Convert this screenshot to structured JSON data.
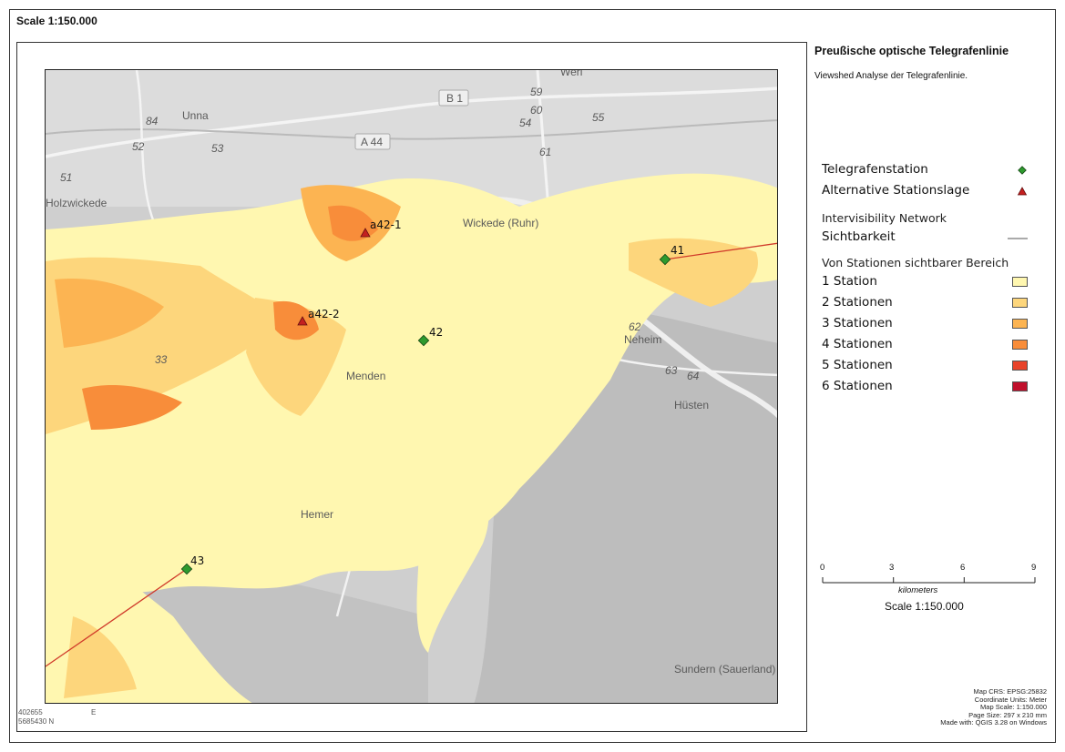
{
  "layout": {
    "scale_top": "Scale 1:150.000",
    "coord_x": "402655",
    "coord_e": "E",
    "coord_y": "5685430 N"
  },
  "title": "Preußische optische Telegrafenlinie",
  "subtitle": "Viewshed Analyse der Telegrafenlinie.",
  "legend": {
    "telegraph_station": "Telegrafenstation",
    "alt_station": "Alternative Stationslage",
    "network_heading": "Intervisibility Network",
    "visibility": "Sichtbarkeit",
    "viewshed_heading": "Von Stationen sichtbarer Bereich",
    "classes": [
      {
        "label": "1 Station",
        "color": "#fff7b0"
      },
      {
        "label": "2 Stationen",
        "color": "#fdd67c"
      },
      {
        "label": "3 Stationen",
        "color": "#fcb452"
      },
      {
        "label": "4 Stationen",
        "color": "#f88d3a"
      },
      {
        "label": "5 Stationen",
        "color": "#e8432a"
      },
      {
        "label": "6 Stationen",
        "color": "#c0102c"
      }
    ],
    "station_color": "#2e9a2e",
    "alt_color": "#c42020",
    "line_color": "#d03a2a"
  },
  "scalebar": {
    "ticks": [
      "0",
      "3",
      "6",
      "9"
    ],
    "unit": "kilometers",
    "scale_text": "Scale 1:150.000"
  },
  "info": {
    "crs": "Map CRS: EPSG:25832",
    "units": "Coordinate Units: Meter",
    "scale": "Map Scale:  1:150.000",
    "page": "Page Size: 297 x 210 mm",
    "made": "Made with: QGIS 3.28 on Windows"
  },
  "map": {
    "places": [
      "Unna",
      "Holzwickede",
      "Wickede (Ruhr)",
      "Menden",
      "Neheim",
      "Hüsten",
      "Hemer",
      "Sundern (Sauerland)",
      "Werl"
    ],
    "roads": [
      "B 1",
      "A 44",
      "84",
      "52",
      "53",
      "51",
      "59",
      "60",
      "54",
      "55",
      "61",
      "62",
      "63",
      "64",
      "33"
    ],
    "stations": [
      {
        "id": "41",
        "type": "station"
      },
      {
        "id": "42",
        "type": "station"
      },
      {
        "id": "43",
        "type": "station"
      },
      {
        "id": "a42-1",
        "type": "alternative"
      },
      {
        "id": "a42-2",
        "type": "alternative"
      }
    ]
  }
}
